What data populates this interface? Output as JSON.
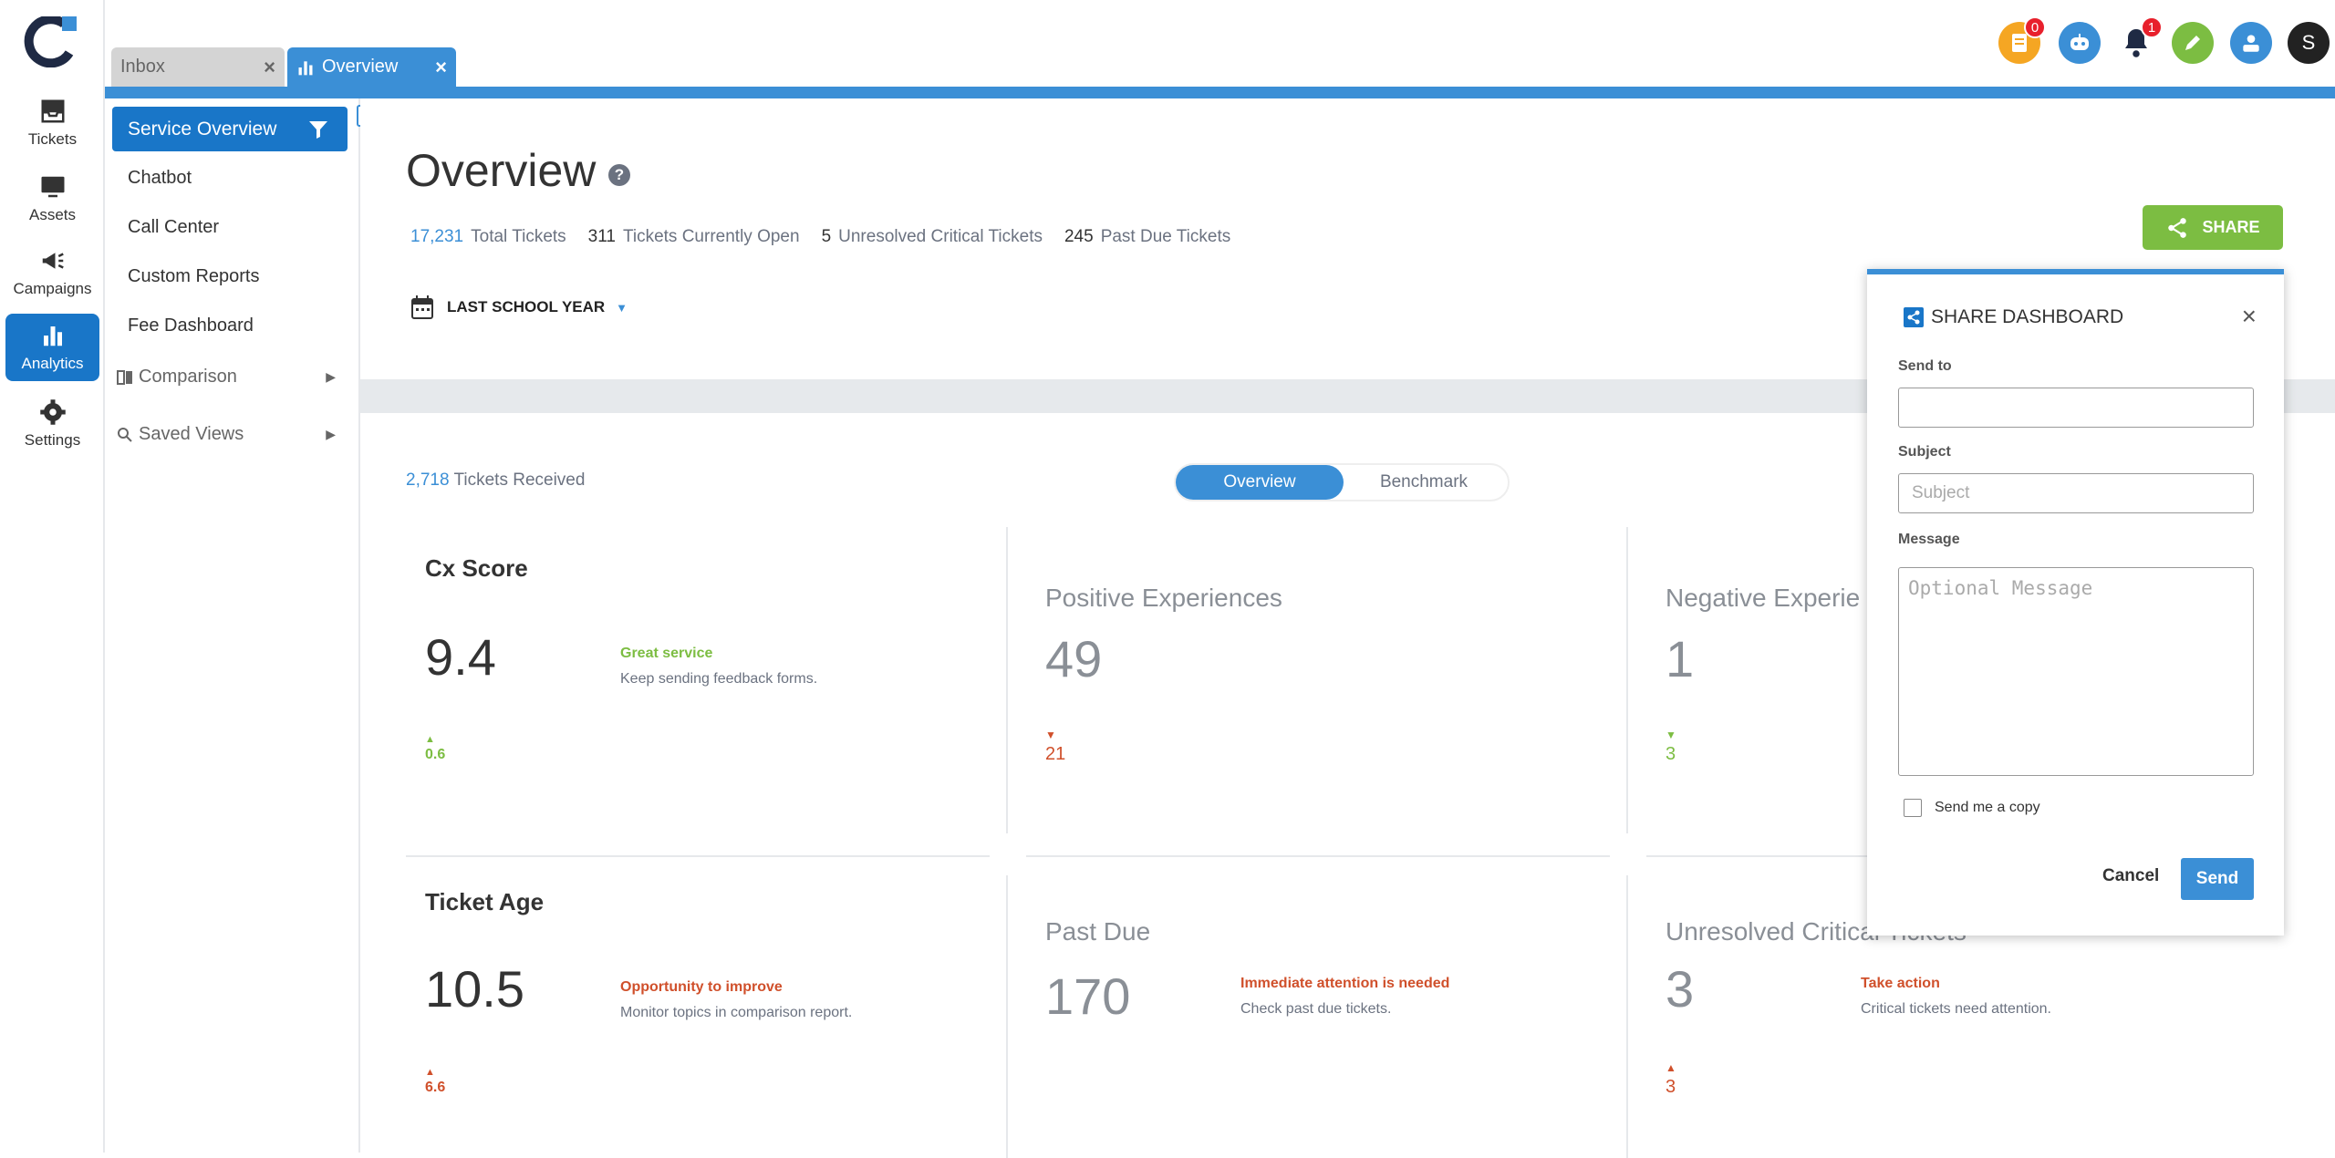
{
  "rail": {
    "items": [
      {
        "label": "Tickets",
        "icon": "inbox-tray-icon"
      },
      {
        "label": "Assets",
        "icon": "monitor-icon"
      },
      {
        "label": "Campaigns",
        "icon": "megaphone-icon"
      },
      {
        "label": "Analytics",
        "icon": "bar-chart-icon",
        "active": true
      },
      {
        "label": "Settings",
        "icon": "gear-icon"
      }
    ]
  },
  "tabs": [
    {
      "label": "Inbox",
      "close": "×"
    },
    {
      "label": "Overview",
      "close": "×",
      "active": true
    }
  ],
  "topbar": {
    "notes_badge": "0",
    "notifications_badge": "1",
    "avatar_initial": "S"
  },
  "sidebar": {
    "active": "Service Overview",
    "items": [
      "Chatbot",
      "Call Center",
      "Custom Reports",
      "Fee Dashboard"
    ],
    "comparison": "Comparison",
    "saved_views": "Saved Views"
  },
  "header": {
    "title": "Overview",
    "help": "?",
    "stats": [
      {
        "value": "17,231",
        "label": "Total Tickets"
      },
      {
        "value": "311",
        "label": "Tickets Currently Open"
      },
      {
        "value": "5",
        "label": "Unresolved Critical Tickets"
      },
      {
        "value": "245",
        "label": "Past Due Tickets"
      }
    ],
    "date_filter": "LAST SCHOOL YEAR",
    "share_label": "SHARE"
  },
  "summary": {
    "received_value": "2,718",
    "received_label": "Tickets Received",
    "toggle": [
      "Overview",
      "Benchmark"
    ]
  },
  "cards": {
    "cx": {
      "title": "Cx Score",
      "value": "9.4",
      "note_title": "Great service",
      "note_text": "Keep sending feedback forms.",
      "delta": "0.6"
    },
    "positive": {
      "title": "Positive Experiences",
      "value": "49",
      "delta": "21"
    },
    "negative": {
      "title": "Negative Experie",
      "value": "1",
      "delta": "3"
    },
    "age": {
      "title": "Ticket Age",
      "value": "10.5",
      "note_title": "Opportunity to improve",
      "note_text": "Monitor topics in comparison report.",
      "delta": "6.6"
    },
    "pastdue": {
      "title": "Past Due",
      "value": "170",
      "note_title": "Immediate attention is needed",
      "note_text": "Check past due tickets."
    },
    "critical": {
      "title": "Unresolved Critical Tickets",
      "value": "3",
      "note_title": "Take action",
      "note_text": "Critical tickets need attention.",
      "delta": "3"
    }
  },
  "modal": {
    "title": "SHARE DASHBOARD",
    "close": "×",
    "send_to_label": "Send to",
    "send_to_value": "",
    "subject_label": "Subject",
    "subject_placeholder": "Subject",
    "message_label": "Message",
    "message_placeholder": "Optional Message",
    "copy_label": "Send me a copy",
    "cancel": "Cancel",
    "send": "Send"
  },
  "colors": {
    "primary_blue": "#3b8fd6",
    "active_blue": "#1976c8",
    "share_green": "#7cbd42",
    "delta_red": "#d0502b",
    "badge_red": "#e8202c"
  }
}
